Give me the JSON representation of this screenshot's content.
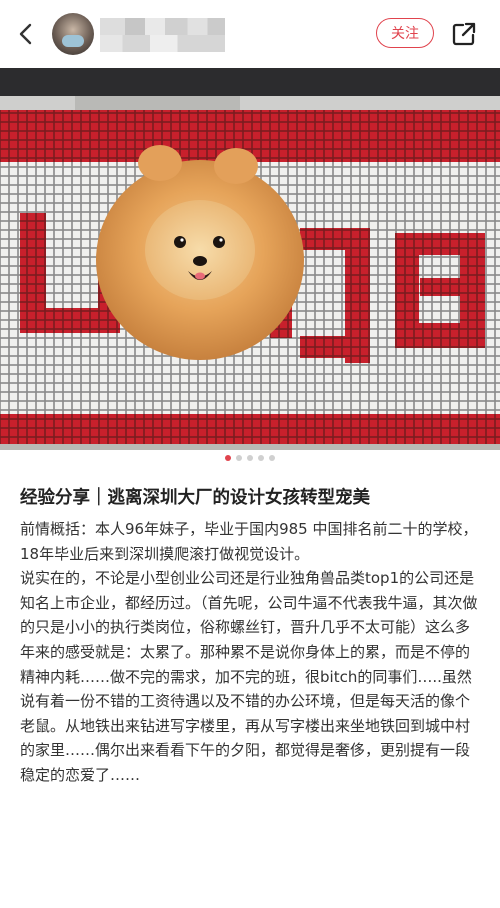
{
  "header": {
    "follow_label": "关注",
    "icons": {
      "back": "chevron-left-icon",
      "share": "share-icon"
    }
  },
  "carousel": {
    "total": 5,
    "active": 0
  },
  "note": {
    "title": "经验分享｜逃离深圳大厂的设计女孩转型宠美",
    "paragraphs": [
      "前情概括：本人96年妹子，毕业于国内985 中国排名前二十的学校，18年毕业后来到深圳摸爬滚打做视觉设计。",
      "说实在的，不论是小型创业公司还是行业独角兽品类top1的公司还是知名上市企业，都经历过。（首先呢，公司牛逼不代表我牛逼，其次做的只是小小的执行类岗位，俗称螺丝钉，晋升几乎不太可能）这么多年来的感受就是：太累了。那种累不是说你身体上的累，而是不停的精神内耗……做不完的需求，加不完的班，很bitch的同事们…..虽然说有着一份不错的工资待遇以及不错的办公环境，但是每天活的像个老鼠。从地铁出来钻进写字楼里，再从写字楼出来坐地铁回到城中村的家里……偶尔出来看看下午的夕阳，都觉得是奢侈，更别提有一段稳定的恋爱了……"
    ]
  },
  "colors": {
    "accent": "#e0434d",
    "tile_red": "#c8202c"
  }
}
